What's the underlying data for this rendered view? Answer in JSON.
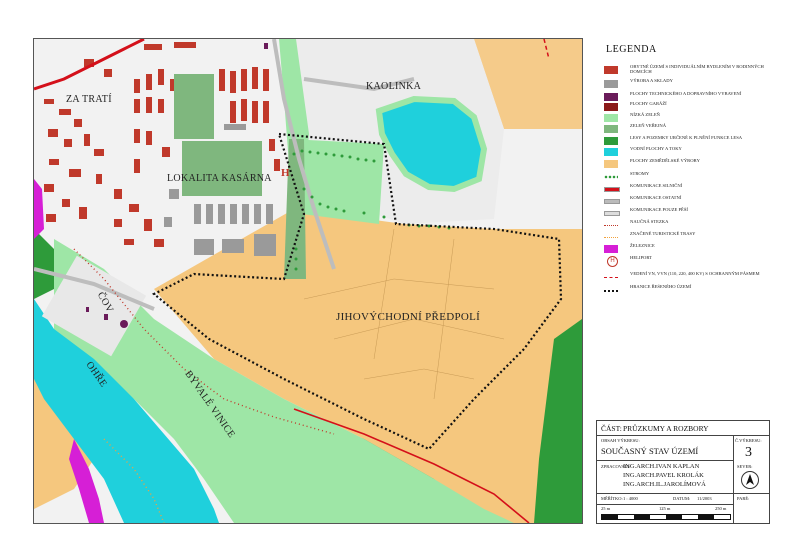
{
  "map": {
    "labels": {
      "za_trati": "ZA TRATÍ",
      "kaolinka": "KAOLINKA",
      "lokalita_kasarna": "LOKALITA KASÁRNA",
      "cov": "ČOV",
      "ohre": "OHŘE",
      "byvale_vinice": "BÝVALÉ VINICE",
      "jihovychodni_predpoli": "JIHOVÝCHODNÍ PŘEDPOLÍ",
      "heliport_mark": "H"
    }
  },
  "legend": {
    "title": "LEGENDA",
    "items": [
      {
        "label": "Obytné území s individuálním bydlením v rodinných domcích",
        "color": "#c0392b",
        "symbol": "fill"
      },
      {
        "label": "Výroba a sklady",
        "color": "#9a9a9a",
        "symbol": "fill"
      },
      {
        "label": "Plochy technického a dopravního vybavení",
        "color": "#6a1b5a",
        "symbol": "fill"
      },
      {
        "label": "Plochy garáží",
        "color": "#8b1a1a",
        "symbol": "fill"
      },
      {
        "label": "Nízká zeleň",
        "color": "#9ee6a6",
        "symbol": "fill"
      },
      {
        "label": "Zeleň veřejná",
        "color": "#7fb77e",
        "symbol": "fill"
      },
      {
        "label": "Lesy a pozemky určené k plnění funkce lesa",
        "color": "#2e9b3a",
        "symbol": "fill"
      },
      {
        "label": "Vodní plochy a toky",
        "color": "#1fd0dc",
        "symbol": "fill"
      },
      {
        "label": "Plochy zemědělské výroby",
        "color": "#f5c77e",
        "symbol": "fill"
      },
      {
        "label": "Stromy",
        "color": "#2e9b3a",
        "symbol": "dots"
      },
      {
        "label": "Komunikace silniční",
        "color": "#d4101a",
        "symbol": "line"
      },
      {
        "label": "Komunikace ostatní",
        "color": "#bbbbbb",
        "symbol": "line"
      },
      {
        "label": "Komunikace pouze pěší",
        "color": "#dddddd",
        "symbol": "line"
      },
      {
        "label": "Naučná stezka",
        "color": "#c0392b",
        "symbol": "dotted"
      },
      {
        "label": "Značené turistické trasy",
        "color": "#f2a23c",
        "symbol": "dotted"
      },
      {
        "label": "Železnice",
        "color": "#d61fd6",
        "symbol": "fill"
      },
      {
        "label": "Heliport",
        "color": "#c0392b",
        "symbol": "heliport"
      },
      {
        "label": "Vedení VN, VVN (110, 220, 400 kV) s ochranným pásmem",
        "color": "#d4101a",
        "symbol": "dashed"
      },
      {
        "label": "Hranice řešeného území",
        "color": "#111111",
        "symbol": "boundary"
      }
    ]
  },
  "titlebox": {
    "cast_label": "ČÁST:",
    "cast_value": "PRŮZKUMY A ROZBORY",
    "obsah_label": "OBSAH VÝKRESU:",
    "obsah_value": "SOUČASNÝ STAV ÚZEMÍ",
    "cislo_label": "Č.VÝKRESU:",
    "cislo_value": "3",
    "zpracoval_label": "ZPRACOVALI:",
    "authors": [
      "ING.ARCH.IVAN KAPLAN",
      "ING.ARCH.PAVEL KROLÁK",
      "ING.ARCH.IL.JAROLÍMOVÁ"
    ],
    "sever_label": "SEVER:",
    "meritko_label": "MĚŘÍTKO:",
    "meritko_value": "1 : 4000",
    "datum_label": "DATUM:",
    "datum_value": "11/2003",
    "pare_label": "PARÉ:",
    "scale_ticks": [
      "25 m",
      "125 m",
      "250 m"
    ]
  },
  "colors": {
    "residential": "#c0392b",
    "industry": "#9a9a9a",
    "technical": "#6a1b5a",
    "garages": "#8b1a1a",
    "low_green": "#9ee6a6",
    "public_green": "#7fb77e",
    "forest": "#2e9b3a",
    "water": "#1fd0dc",
    "agri": "#f5c77e",
    "road": "#d4101a",
    "railway": "#d61fd6"
  }
}
